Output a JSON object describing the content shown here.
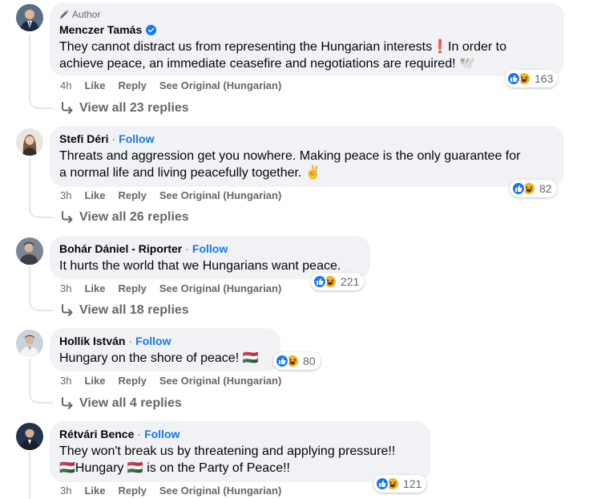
{
  "comments": [
    {
      "author_tag": "Author",
      "name": "Menczer Tamás",
      "verified": true,
      "text_lines": [
        "They cannot distract us from representing the Hungarian interests❗In order to",
        "achieve peace, an immediate ceasefire and negotiations are required! 🕊️"
      ],
      "time": "4h",
      "like": "Like",
      "reply": "Reply",
      "see_original": "See Original (Hungarian)",
      "reactions": "163",
      "view_replies": "View all 23 replies"
    },
    {
      "name": "Stefi Déri",
      "follow": "Follow",
      "text_lines": [
        "Threats and aggression get you nowhere. Making peace is the only guarantee for",
        "a normal life and living peacefully together. ✌️"
      ],
      "time": "3h",
      "like": "Like",
      "reply": "Reply",
      "see_original": "See Original (Hungarian)",
      "reactions": "82",
      "view_replies": "View all 26 replies"
    },
    {
      "name": "Bohár Dániel - Riporter",
      "follow": "Follow",
      "text_lines": [
        "It hurts the world that we Hungarians want peace."
      ],
      "time": "3h",
      "like": "Like",
      "reply": "Reply",
      "see_original": "See Original (Hungarian)",
      "reactions": "221",
      "view_replies": "View all 18 replies"
    },
    {
      "name": "Hollik István",
      "follow": "Follow",
      "text_lines": [
        "Hungary on the shore of peace! 🇭🇺"
      ],
      "time": "3h",
      "like": "Like",
      "reply": "Reply",
      "see_original": "See Original (Hungarian)",
      "reactions": "80",
      "view_replies": "View all 4 replies"
    },
    {
      "name": "Rétvári Bence",
      "follow": "Follow",
      "text_lines": [
        "They won't break us by threatening and applying pressure!!",
        "🇭🇺Hungary 🇭🇺 is on the Party of Peace!!"
      ],
      "time": "3h",
      "like": "Like",
      "reply": "Reply",
      "see_original": "See Original (Hungarian)",
      "reactions": "121"
    }
  ],
  "colors": {
    "bubble": "#f0f2f5",
    "link_blue": "#1877f2",
    "secondary_text": "#65676b",
    "haha_yellow": "#f7b125"
  }
}
